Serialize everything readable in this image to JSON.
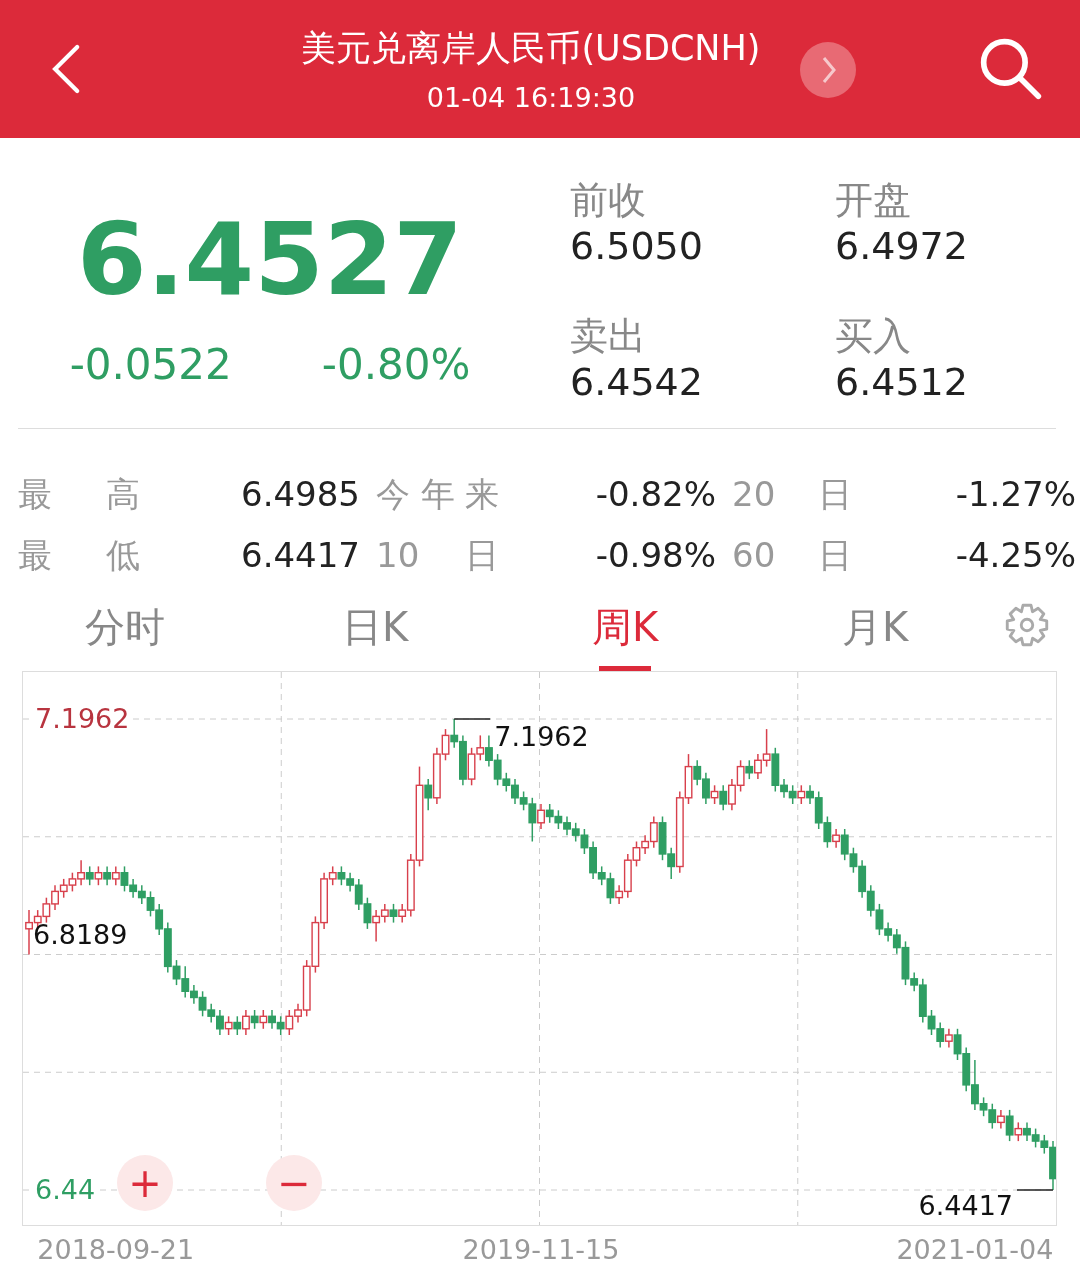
{
  "header": {
    "title": "美元兑离岸人民币(USDCNH)",
    "time": "01-04 16:19:30"
  },
  "quote": {
    "price": "6.4527",
    "change": "-0.0522",
    "change_pct": "-0.80%",
    "fields": [
      {
        "label": "前收",
        "value": "6.5050"
      },
      {
        "label": "开盘",
        "value": "6.4972"
      },
      {
        "label": "卖出",
        "value": "6.4542"
      },
      {
        "label": "买入",
        "value": "6.4512"
      }
    ]
  },
  "stats": [
    {
      "label": "最 高",
      "value": "6.4985"
    },
    {
      "label": "今年来",
      "value": "-0.82%"
    },
    {
      "label": "20 日",
      "value": "-1.27%"
    },
    {
      "label": "最 低",
      "value": "6.4417"
    },
    {
      "label": "10 日",
      "value": "-0.98%"
    },
    {
      "label": "60 日",
      "value": "-4.25%"
    }
  ],
  "tabs": [
    {
      "label": "分时",
      "selected": false
    },
    {
      "label": "日K",
      "selected": false
    },
    {
      "label": "周K",
      "selected": true
    },
    {
      "label": "月K",
      "selected": false
    }
  ],
  "chart": {
    "zoom_in": "+",
    "zoom_out": "−",
    "chart_data": {
      "type": "candlestick",
      "categories": [
        null,
        null,
        null,
        null,
        null,
        null,
        null,
        null,
        null,
        null,
        "2018-09-21",
        null,
        null,
        null,
        null,
        null,
        null,
        null,
        null,
        null,
        null,
        null,
        null,
        null,
        null,
        null,
        null,
        null,
        null,
        null,
        null,
        null,
        null,
        null,
        null,
        null,
        null,
        null,
        null,
        null,
        null,
        null,
        null,
        null,
        null,
        null,
        null,
        null,
        null,
        null,
        null,
        null,
        null,
        null,
        null,
        null,
        null,
        null,
        null,
        "2019-11-15",
        null,
        null,
        null,
        null,
        null,
        null,
        null,
        null,
        null,
        null,
        null,
        null,
        null,
        null,
        null,
        null,
        null,
        null,
        null,
        null,
        null,
        null,
        null,
        null,
        null,
        null,
        null,
        null,
        null,
        null,
        null,
        null,
        null,
        null,
        null,
        null,
        null,
        null,
        null,
        null,
        null,
        null,
        null,
        null,
        null,
        null,
        null,
        null,
        null,
        "2021-01-04",
        null,
        null,
        null,
        null,
        null,
        null,
        null,
        null,
        null
      ],
      "ohlc": [
        [
          6.86,
          6.89,
          6.8189,
          6.87
        ],
        [
          6.87,
          6.89,
          6.86,
          6.88
        ],
        [
          6.88,
          6.91,
          6.87,
          6.9
        ],
        [
          6.9,
          6.93,
          6.89,
          6.92
        ],
        [
          6.92,
          6.94,
          6.91,
          6.93
        ],
        [
          6.93,
          6.95,
          6.92,
          6.94
        ],
        [
          6.94,
          6.97,
          6.93,
          6.95
        ],
        [
          6.95,
          6.96,
          6.93,
          6.94
        ],
        [
          6.94,
          6.96,
          6.93,
          6.95
        ],
        [
          6.95,
          6.96,
          6.93,
          6.94
        ],
        [
          6.94,
          6.96,
          6.93,
          6.95
        ],
        [
          6.95,
          6.96,
          6.92,
          6.93
        ],
        [
          6.93,
          6.94,
          6.91,
          6.92
        ],
        [
          6.92,
          6.93,
          6.9,
          6.91
        ],
        [
          6.91,
          6.92,
          6.88,
          6.89
        ],
        [
          6.89,
          6.9,
          6.85,
          6.86
        ],
        [
          6.86,
          6.87,
          6.79,
          6.8
        ],
        [
          6.8,
          6.81,
          6.77,
          6.78
        ],
        [
          6.78,
          6.8,
          6.75,
          6.76
        ],
        [
          6.76,
          6.77,
          6.74,
          6.75
        ],
        [
          6.75,
          6.76,
          6.72,
          6.73
        ],
        [
          6.73,
          6.74,
          6.71,
          6.72
        ],
        [
          6.72,
          6.73,
          6.69,
          6.7
        ],
        [
          6.7,
          6.72,
          6.69,
          6.71
        ],
        [
          6.71,
          6.72,
          6.69,
          6.7
        ],
        [
          6.7,
          6.73,
          6.69,
          6.72
        ],
        [
          6.72,
          6.73,
          6.7,
          6.71
        ],
        [
          6.71,
          6.73,
          6.7,
          6.72
        ],
        [
          6.72,
          6.73,
          6.7,
          6.71
        ],
        [
          6.71,
          6.72,
          6.69,
          6.7
        ],
        [
          6.7,
          6.73,
          6.69,
          6.72
        ],
        [
          6.72,
          6.74,
          6.71,
          6.73
        ],
        [
          6.73,
          6.81,
          6.72,
          6.8
        ],
        [
          6.8,
          6.88,
          6.79,
          6.87
        ],
        [
          6.87,
          6.95,
          6.86,
          6.94
        ],
        [
          6.94,
          6.96,
          6.93,
          6.95
        ],
        [
          6.95,
          6.96,
          6.93,
          6.94
        ],
        [
          6.94,
          6.95,
          6.92,
          6.93
        ],
        [
          6.93,
          6.94,
          6.89,
          6.9
        ],
        [
          6.9,
          6.91,
          6.86,
          6.87
        ],
        [
          6.87,
          6.89,
          6.84,
          6.88
        ],
        [
          6.88,
          6.9,
          6.87,
          6.89
        ],
        [
          6.89,
          6.9,
          6.87,
          6.88
        ],
        [
          6.88,
          6.9,
          6.87,
          6.89
        ],
        [
          6.89,
          6.98,
          6.88,
          6.97
        ],
        [
          6.97,
          7.12,
          6.96,
          7.09
        ],
        [
          7.09,
          7.1,
          7.05,
          7.07
        ],
        [
          7.07,
          7.15,
          7.06,
          7.14
        ],
        [
          7.14,
          7.18,
          7.13,
          7.17
        ],
        [
          7.17,
          7.1962,
          7.15,
          7.16
        ],
        [
          7.16,
          7.17,
          7.09,
          7.1
        ],
        [
          7.1,
          7.15,
          7.09,
          7.14
        ],
        [
          7.14,
          7.17,
          7.13,
          7.15
        ],
        [
          7.15,
          7.17,
          7.12,
          7.13
        ],
        [
          7.13,
          7.14,
          7.09,
          7.1
        ],
        [
          7.1,
          7.11,
          7.08,
          7.09
        ],
        [
          7.09,
          7.1,
          7.06,
          7.07
        ],
        [
          7.07,
          7.08,
          7.05,
          7.06
        ],
        [
          7.06,
          7.07,
          7.0,
          7.03
        ],
        [
          7.03,
          7.06,
          7.02,
          7.05
        ],
        [
          7.05,
          7.06,
          7.03,
          7.04
        ],
        [
          7.04,
          7.05,
          7.02,
          7.03
        ],
        [
          7.03,
          7.04,
          7.01,
          7.02
        ],
        [
          7.02,
          7.03,
          7.0,
          7.01
        ],
        [
          7.01,
          7.02,
          6.98,
          6.99
        ],
        [
          6.99,
          7.0,
          6.94,
          6.95
        ],
        [
          6.95,
          6.96,
          6.93,
          6.94
        ],
        [
          6.94,
          6.95,
          6.9,
          6.91
        ],
        [
          6.91,
          6.93,
          6.9,
          6.92
        ],
        [
          6.92,
          6.98,
          6.91,
          6.97
        ],
        [
          6.97,
          7.0,
          6.96,
          6.99
        ],
        [
          6.99,
          7.01,
          6.98,
          7.0
        ],
        [
          7.0,
          7.04,
          6.99,
          7.03
        ],
        [
          7.03,
          7.04,
          6.97,
          6.98
        ],
        [
          6.98,
          6.99,
          6.94,
          6.96
        ],
        [
          6.96,
          7.08,
          6.95,
          7.07
        ],
        [
          7.07,
          7.14,
          7.06,
          7.12
        ],
        [
          7.12,
          7.13,
          7.09,
          7.1
        ],
        [
          7.1,
          7.11,
          7.06,
          7.07
        ],
        [
          7.07,
          7.09,
          7.06,
          7.08
        ],
        [
          7.08,
          7.09,
          7.05,
          7.06
        ],
        [
          7.06,
          7.1,
          7.05,
          7.09
        ],
        [
          7.09,
          7.13,
          7.08,
          7.12
        ],
        [
          7.12,
          7.13,
          7.1,
          7.11
        ],
        [
          7.11,
          7.14,
          7.1,
          7.13
        ],
        [
          7.13,
          7.18,
          7.12,
          7.14
        ],
        [
          7.14,
          7.15,
          7.08,
          7.09
        ],
        [
          7.09,
          7.1,
          7.07,
          7.08
        ],
        [
          7.08,
          7.09,
          7.06,
          7.07
        ],
        [
          7.07,
          7.09,
          7.06,
          7.08
        ],
        [
          7.08,
          7.09,
          7.06,
          7.07
        ],
        [
          7.07,
          7.08,
          7.02,
          7.03
        ],
        [
          7.03,
          7.04,
          6.99,
          7.0
        ],
        [
          7.0,
          7.02,
          6.99,
          7.01
        ],
        [
          7.01,
          7.02,
          6.97,
          6.98
        ],
        [
          6.98,
          6.99,
          6.95,
          6.96
        ],
        [
          6.96,
          6.97,
          6.91,
          6.92
        ],
        [
          6.92,
          6.93,
          6.88,
          6.89
        ],
        [
          6.89,
          6.9,
          6.85,
          6.86
        ],
        [
          6.86,
          6.87,
          6.84,
          6.85
        ],
        [
          6.85,
          6.86,
          6.82,
          6.83
        ],
        [
          6.83,
          6.84,
          6.77,
          6.78
        ],
        [
          6.78,
          6.79,
          6.76,
          6.77
        ],
        [
          6.77,
          6.78,
          6.71,
          6.72
        ],
        [
          6.72,
          6.73,
          6.69,
          6.7
        ],
        [
          6.7,
          6.71,
          6.67,
          6.68
        ],
        [
          6.68,
          6.7,
          6.67,
          6.69
        ],
        [
          6.69,
          6.7,
          6.65,
          6.66
        ],
        [
          6.66,
          6.67,
          6.6,
          6.61
        ],
        [
          6.61,
          6.65,
          6.57,
          6.58
        ],
        [
          6.58,
          6.59,
          6.56,
          6.57
        ],
        [
          6.57,
          6.58,
          6.54,
          6.55
        ],
        [
          6.55,
          6.57,
          6.54,
          6.56
        ],
        [
          6.56,
          6.57,
          6.52,
          6.53
        ],
        [
          6.53,
          6.55,
          6.52,
          6.54
        ],
        [
          6.54,
          6.55,
          6.52,
          6.53
        ],
        [
          6.53,
          6.54,
          6.51,
          6.52
        ],
        [
          6.52,
          6.53,
          6.5,
          6.51
        ],
        [
          6.51,
          6.52,
          6.4417,
          6.46
        ]
      ],
      "ylim": [
        6.4417,
        7.1962
      ],
      "yticks": [
        {
          "value": 7.1962,
          "label": "7.1962"
        },
        {
          "value": 6.4417,
          "label": "6.44"
        }
      ],
      "annotations": [
        "7.1962",
        "6.8189",
        "6.4417"
      ]
    }
  }
}
